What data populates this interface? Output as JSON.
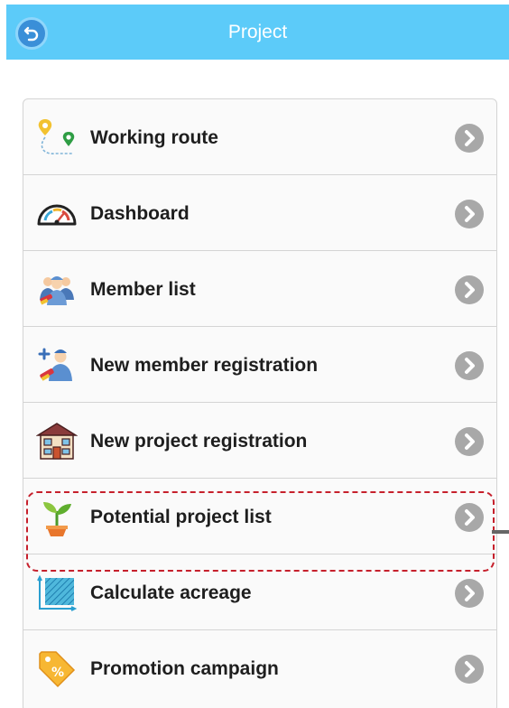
{
  "header": {
    "title": "Project",
    "back_icon": "back-arrow-icon",
    "color": "#5ccbf9"
  },
  "menu": {
    "items": [
      {
        "label": "Working route",
        "icon": "map-pin-route-icon"
      },
      {
        "label": "Dashboard",
        "icon": "gauge-icon"
      },
      {
        "label": "Member list",
        "icon": "team-members-icon"
      },
      {
        "label": "New member registration",
        "icon": "add-member-icon"
      },
      {
        "label": "New project registration",
        "icon": "house-icon"
      },
      {
        "label": "Potential project list",
        "icon": "sprout-icon"
      },
      {
        "label": "Calculate acreage",
        "icon": "area-measure-icon"
      },
      {
        "label": "Promotion campaign",
        "icon": "discount-tag-icon"
      }
    ],
    "highlighted_item": "Potential project list",
    "highlight_color": "#c6202c"
  }
}
